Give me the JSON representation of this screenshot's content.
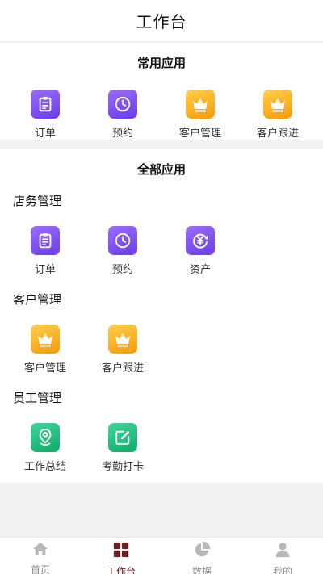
{
  "header": {
    "title": "工作台"
  },
  "common": {
    "title": "常用应用",
    "items": [
      {
        "label": "订单",
        "icon": "clipboard-icon"
      },
      {
        "label": "预约",
        "icon": "clock-icon"
      },
      {
        "label": "客户管理",
        "icon": "crown-icon"
      },
      {
        "label": "客户跟进",
        "icon": "crown-icon"
      }
    ]
  },
  "all": {
    "title": "全部应用",
    "groups": [
      {
        "title": "店务管理",
        "items": [
          {
            "label": "订单",
            "icon": "clipboard-icon"
          },
          {
            "label": "预约",
            "icon": "clock-icon"
          },
          {
            "label": "资产",
            "icon": "yen-refresh-icon"
          }
        ]
      },
      {
        "title": "客户管理",
        "items": [
          {
            "label": "客户管理",
            "icon": "crown-icon"
          },
          {
            "label": "客户跟进",
            "icon": "crown-icon"
          }
        ]
      },
      {
        "title": "员工管理",
        "items": [
          {
            "label": "工作总结",
            "icon": "location-pin-icon"
          },
          {
            "label": "考勤打卡",
            "icon": "edit-icon"
          }
        ]
      }
    ]
  },
  "tabbar": {
    "active_color": "#6b1f22",
    "inactive_color": "#8e8e8e",
    "items": [
      {
        "label": "首页",
        "icon": "home-icon"
      },
      {
        "label": "工作台",
        "icon": "grid-icon"
      },
      {
        "label": "数据",
        "icon": "pie-chart-icon"
      },
      {
        "label": "我的",
        "icon": "user-icon"
      }
    ]
  }
}
